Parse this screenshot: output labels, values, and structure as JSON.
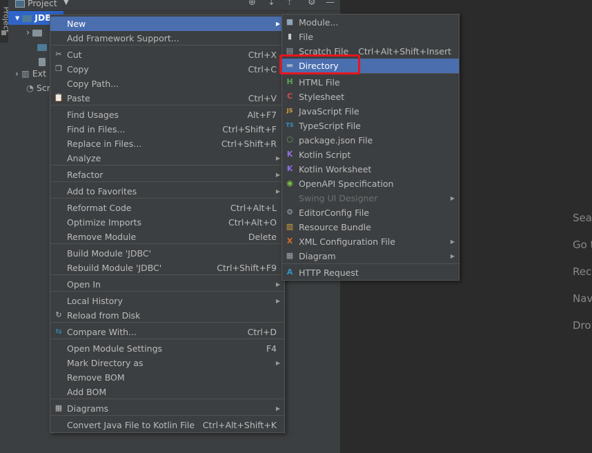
{
  "project_panel": {
    "side_tab_label": "Project",
    "header_title": "Project",
    "tree": [
      {
        "label": "JDBC"
      },
      {
        "label": ""
      },
      {
        "label": ""
      },
      {
        "label": ""
      },
      {
        "label": "Ext"
      },
      {
        "label": "Scr"
      }
    ]
  },
  "editor_hints": [
    "Sea",
    "Go t",
    "Rec",
    "Nav",
    "Dro"
  ],
  "context_menu": {
    "items": [
      {
        "label": "New",
        "shortcut": "",
        "submenu": true,
        "icon": ""
      },
      {
        "label": "Add Framework Support...",
        "shortcut": "",
        "submenu": false,
        "icon": ""
      },
      {
        "label": "Cut",
        "shortcut": "Ctrl+X",
        "submenu": false,
        "icon": "scissors-icon"
      },
      {
        "label": "Copy",
        "shortcut": "Ctrl+C",
        "submenu": false,
        "icon": "copy-icon"
      },
      {
        "label": "Copy Path...",
        "shortcut": "",
        "submenu": false,
        "icon": ""
      },
      {
        "label": "Paste",
        "shortcut": "Ctrl+V",
        "submenu": false,
        "icon": "paste-icon"
      },
      {
        "label": "Find Usages",
        "shortcut": "Alt+F7",
        "submenu": false,
        "icon": ""
      },
      {
        "label": "Find in Files...",
        "shortcut": "Ctrl+Shift+F",
        "submenu": false,
        "icon": ""
      },
      {
        "label": "Replace in Files...",
        "shortcut": "Ctrl+Shift+R",
        "submenu": false,
        "icon": ""
      },
      {
        "label": "Analyze",
        "shortcut": "",
        "submenu": true,
        "icon": ""
      },
      {
        "label": "Refactor",
        "shortcut": "",
        "submenu": true,
        "icon": ""
      },
      {
        "label": "Add to Favorites",
        "shortcut": "",
        "submenu": true,
        "icon": ""
      },
      {
        "label": "Reformat Code",
        "shortcut": "Ctrl+Alt+L",
        "submenu": false,
        "icon": ""
      },
      {
        "label": "Optimize Imports",
        "shortcut": "Ctrl+Alt+O",
        "submenu": false,
        "icon": ""
      },
      {
        "label": "Remove Module",
        "shortcut": "Delete",
        "submenu": false,
        "icon": ""
      },
      {
        "label": "Build Module 'JDBC'",
        "shortcut": "",
        "submenu": false,
        "icon": ""
      },
      {
        "label": "Rebuild Module 'JDBC'",
        "shortcut": "Ctrl+Shift+F9",
        "submenu": false,
        "icon": ""
      },
      {
        "label": "Open In",
        "shortcut": "",
        "submenu": true,
        "icon": ""
      },
      {
        "label": "Local History",
        "shortcut": "",
        "submenu": true,
        "icon": ""
      },
      {
        "label": "Reload from Disk",
        "shortcut": "",
        "submenu": false,
        "icon": "reload-icon"
      },
      {
        "label": "Compare With...",
        "shortcut": "Ctrl+D",
        "submenu": false,
        "icon": "compare-icon"
      },
      {
        "label": "Open Module Settings",
        "shortcut": "F4",
        "submenu": false,
        "icon": ""
      },
      {
        "label": "Mark Directory as",
        "shortcut": "",
        "submenu": true,
        "icon": ""
      },
      {
        "label": "Remove BOM",
        "shortcut": "",
        "submenu": false,
        "icon": ""
      },
      {
        "label": "Add BOM",
        "shortcut": "",
        "submenu": false,
        "icon": ""
      },
      {
        "label": "Diagrams",
        "shortcut": "",
        "submenu": true,
        "icon": "diagram-icon"
      },
      {
        "label": "Convert Java File to Kotlin File",
        "shortcut": "Ctrl+Alt+Shift+K",
        "submenu": false,
        "icon": ""
      }
    ]
  },
  "new_submenu": {
    "items": [
      {
        "label": "Module...",
        "shortcut": "",
        "submenu": false,
        "icon": "module-icon"
      },
      {
        "label": "File",
        "shortcut": "",
        "submenu": false,
        "icon": "file-icon"
      },
      {
        "label": "Scratch File",
        "shortcut": "Ctrl+Alt+Shift+Insert",
        "submenu": false,
        "icon": "scratch-file-icon"
      },
      {
        "label": "Directory",
        "shortcut": "",
        "submenu": false,
        "icon": "folder-icon"
      },
      {
        "label": "HTML File",
        "shortcut": "",
        "submenu": false,
        "icon": "html-file-icon"
      },
      {
        "label": "Stylesheet",
        "shortcut": "",
        "submenu": false,
        "icon": "css-file-icon"
      },
      {
        "label": "JavaScript File",
        "shortcut": "",
        "submenu": false,
        "icon": "js-file-icon"
      },
      {
        "label": "TypeScript File",
        "shortcut": "",
        "submenu": false,
        "icon": "ts-file-icon"
      },
      {
        "label": "package.json File",
        "shortcut": "",
        "submenu": false,
        "icon": "nodejs-icon"
      },
      {
        "label": "Kotlin Script",
        "shortcut": "",
        "submenu": false,
        "icon": "kotlin-icon"
      },
      {
        "label": "Kotlin Worksheet",
        "shortcut": "",
        "submenu": false,
        "icon": "kotlin-icon"
      },
      {
        "label": "OpenAPI Specification",
        "shortcut": "",
        "submenu": false,
        "icon": "openapi-icon"
      },
      {
        "label": "Swing UI Designer",
        "shortcut": "",
        "submenu": true,
        "icon": ""
      },
      {
        "label": "EditorConfig File",
        "shortcut": "",
        "submenu": false,
        "icon": "gear-icon"
      },
      {
        "label": "Resource Bundle",
        "shortcut": "",
        "submenu": false,
        "icon": "resource-bundle-icon"
      },
      {
        "label": "XML Configuration File",
        "shortcut": "",
        "submenu": true,
        "icon": "xml-file-icon"
      },
      {
        "label": "Diagram",
        "shortcut": "",
        "submenu": true,
        "icon": "diagram-icon"
      },
      {
        "label": "HTTP Request",
        "shortcut": "",
        "submenu": false,
        "icon": "api-icon"
      }
    ]
  },
  "colors": {
    "highlight": "#4b6eaf",
    "annotation_box": "#e8141e",
    "panel": "#3c3f41",
    "editor": "#2b2b2b"
  }
}
